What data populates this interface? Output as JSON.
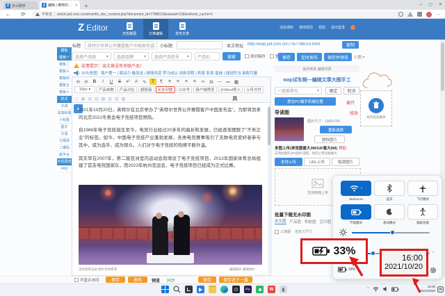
{
  "browser": {
    "tabs": [
      {
        "label": "办公助手"
      },
      {
        "label": "编辑 | 英特尔世界公开赛客户中…"
      }
    ],
    "tab_close": "✕",
    "new_tab": "+",
    "window_controls": {
      "min": "─",
      "max": "▢",
      "close": "✕"
    },
    "back": "←",
    "refresh": "⟳",
    "security": "不安全",
    "url": "article.jsd.com.cn/admin/fix_doc_content.php?document_id=7788013&classid=218&refresh_cache=1",
    "favicon": "Z",
    "more": "⋯"
  },
  "header": {
    "logo_z": "Z",
    "logo_text": "Editor",
    "nav": [
      {
        "label": "无忧稿源"
      },
      {
        "label": "文章编辑"
      },
      {
        "label": "发布文章"
      }
    ],
    "links": [
      {
        "label": "消息通知"
      },
      {
        "label": "使用帮助"
      },
      {
        "label": "帮助"
      },
      {
        "label": "退出登录"
      }
    ]
  },
  "sidebar": {
    "groups": [
      {
        "header": "模板",
        "items": [
          {
            "label": "模板一"
          },
          {
            "label": "模板二"
          },
          {
            "label": "模板三"
          },
          {
            "label": "模板四"
          },
          {
            "label": "模板五"
          },
          {
            "label": "模板六"
          }
        ]
      },
      {
        "header": "样式",
        "items": [
          {
            "label": "引语"
          },
          {
            "label": "段落标题"
          },
          {
            "label": "小标题"
          },
          {
            "label": "图文"
          },
          {
            "label": "引语"
          },
          {
            "label": "分隔线"
          },
          {
            "label": "二维码"
          },
          {
            "label": "超平台"
          }
        ]
      }
    ],
    "mobile_preview": "手机预览",
    "faq": "FAQ"
  },
  "form": {
    "title_label": "标题",
    "title_value": "英特尔世界公开赛暨客户中国发布会举行",
    "subtitle_label": "小标题",
    "url_label": "本文地址",
    "url_value": "http://wap.jsd.com.cn/7767788014.html",
    "copy": "复制",
    "selects": [
      {
        "label": "选择产品线"
      },
      {
        "label": "选择品牌"
      },
      {
        "label": "选择产品型号"
      }
    ],
    "product_id": "产品ID",
    "search": "搜索",
    "checkbox1": "原创稿件",
    "checkbox2": "置顶",
    "warning": "友情提示：该文章没有关联产品！",
    "ticker": "20头条图：客户第一 | 赋动力 触发送 | 精简改变 梦马成认 创新流程 | 刺客 影视 星蛙 | 插进阶当 装配可量",
    "caret": "▾"
  },
  "editor": {
    "toolbar_row1": [
      "⟲",
      "⟳",
      "B",
      "I",
      "U",
      "S",
      "x²",
      "A",
      "✎",
      "T",
      "¶",
      "≡",
      "≡",
      "≡",
      "≡",
      "∞",
      "⊟",
      "—",
      "≔",
      "▦"
    ],
    "toolbar_row2": [
      {
        "label": "16px ▾"
      },
      {
        "label": "产品参数"
      },
      {
        "label": "产品对比"
      },
      {
        "label": "超链接"
      },
      {
        "label": "无水印图"
      },
      {
        "label": "公众号"
      },
      {
        "label": "用户端预览"
      },
      {
        "label": "从Word导入"
      },
      {
        "label": "上传文件"
      }
    ],
    "toolbar_row3": [
      "▢",
      "▣",
      "▤",
      "▥",
      "▦",
      "▧",
      "▨",
      "▩",
      "共"
    ],
    "insert_plus": "+",
    "paragraphs": [
      "2021年10月20日，英特尔在北京举办了“英特尔世界公开赛暨客户中国发布会”，为即将到来的北京2022冬奥会电子竞技项目预热。",
      "自1986年电子竞技诞生至今，电竞行业经过20多年的曲折和发展，已经逐渐摆脱了“不务正业”的标签。如今，中国电子竞技产业蓬勃发展，各类电竞赛事吸引了无数电竞爱好者参与其中，成为选手、成为观众，人们对于电子竞技的热情不断升温。",
      "其实早在2007年，第二届亚洲室内运动会就增设了电子竞技项目，2013年国家体育总局组建了首支电竞国家队，而2023年杭州亚运会，电子竞技项目已经成为正式比赛。"
    ],
    "caption_left": "活动现场记录 图片仅供参考",
    "caption_right": "编辑图片 删除图片"
  },
  "right_panel": {
    "actions": [
      {
        "label": "保存"
      },
      {
        "label": "定时发布"
      },
      {
        "label": "保存并预览"
      }
    ],
    "small_link": "小图 ▾",
    "note": "操作简单 编辑可靠",
    "wap_title": "wap试车频—编辑文章大图手工",
    "recommend_select": "一级推荐位",
    "confirm": "确定",
    "cancel": "取消",
    "submit_btn": "提交PC端手机端位置",
    "expand": "展开",
    "lead_image_title": "导读图",
    "modify": "修改",
    "image_size": "图片尺寸：1080x756",
    "reselect": "重新选择",
    "delete_image": "删除图片",
    "upload_title": "多图上传(单张图最大3M/GIF最大8M)",
    "help": "帮助",
    "upload_note": "支持批量的JPG图片选取，请勿上传违规图片",
    "upload_tabs": [
      {
        "label": "本地上传"
      },
      {
        "label": "URL上传"
      },
      {
        "label": "稿源图片"
      }
    ],
    "dropzone": "支持拖拽上传",
    "batch_title": "批量下载无水印图",
    "batch_tabs": [
      {
        "label": "本文图"
      },
      {
        "label": "产品图"
      },
      {
        "label": "相册图"
      },
      {
        "label": "豆印图"
      }
    ],
    "batch_plus": "+",
    "batch_opt1": "三连图",
    "batch_opt2": "自定义尺寸"
  },
  "recycle": {
    "label": "拖到此处删除"
  },
  "footer": {
    "checkbox": "不显示水印",
    "save": "保存",
    "publish": "发布",
    "preview": "预览",
    "sync": "同步",
    "save2": "保存",
    "save_next": "保存进下一篇"
  },
  "quick_settings": {
    "tiles": [
      {
        "label": "Starbucks"
      },
      {
        "label": "蓝牙"
      },
      {
        "label": "飞行模式"
      },
      {
        "label": "节电模式"
      },
      {
        "label": "夜间模式"
      },
      {
        "label": "辅助功能"
      }
    ],
    "battery_label": "33%",
    "chevron": "›",
    "tile_chevron": "›",
    "caret": "^"
  },
  "callouts": {
    "battery": "33%",
    "time": "16:00",
    "date": "2021/10/20"
  },
  "taskbar": {
    "time": "16:00",
    "date": "2021/10/20"
  }
}
